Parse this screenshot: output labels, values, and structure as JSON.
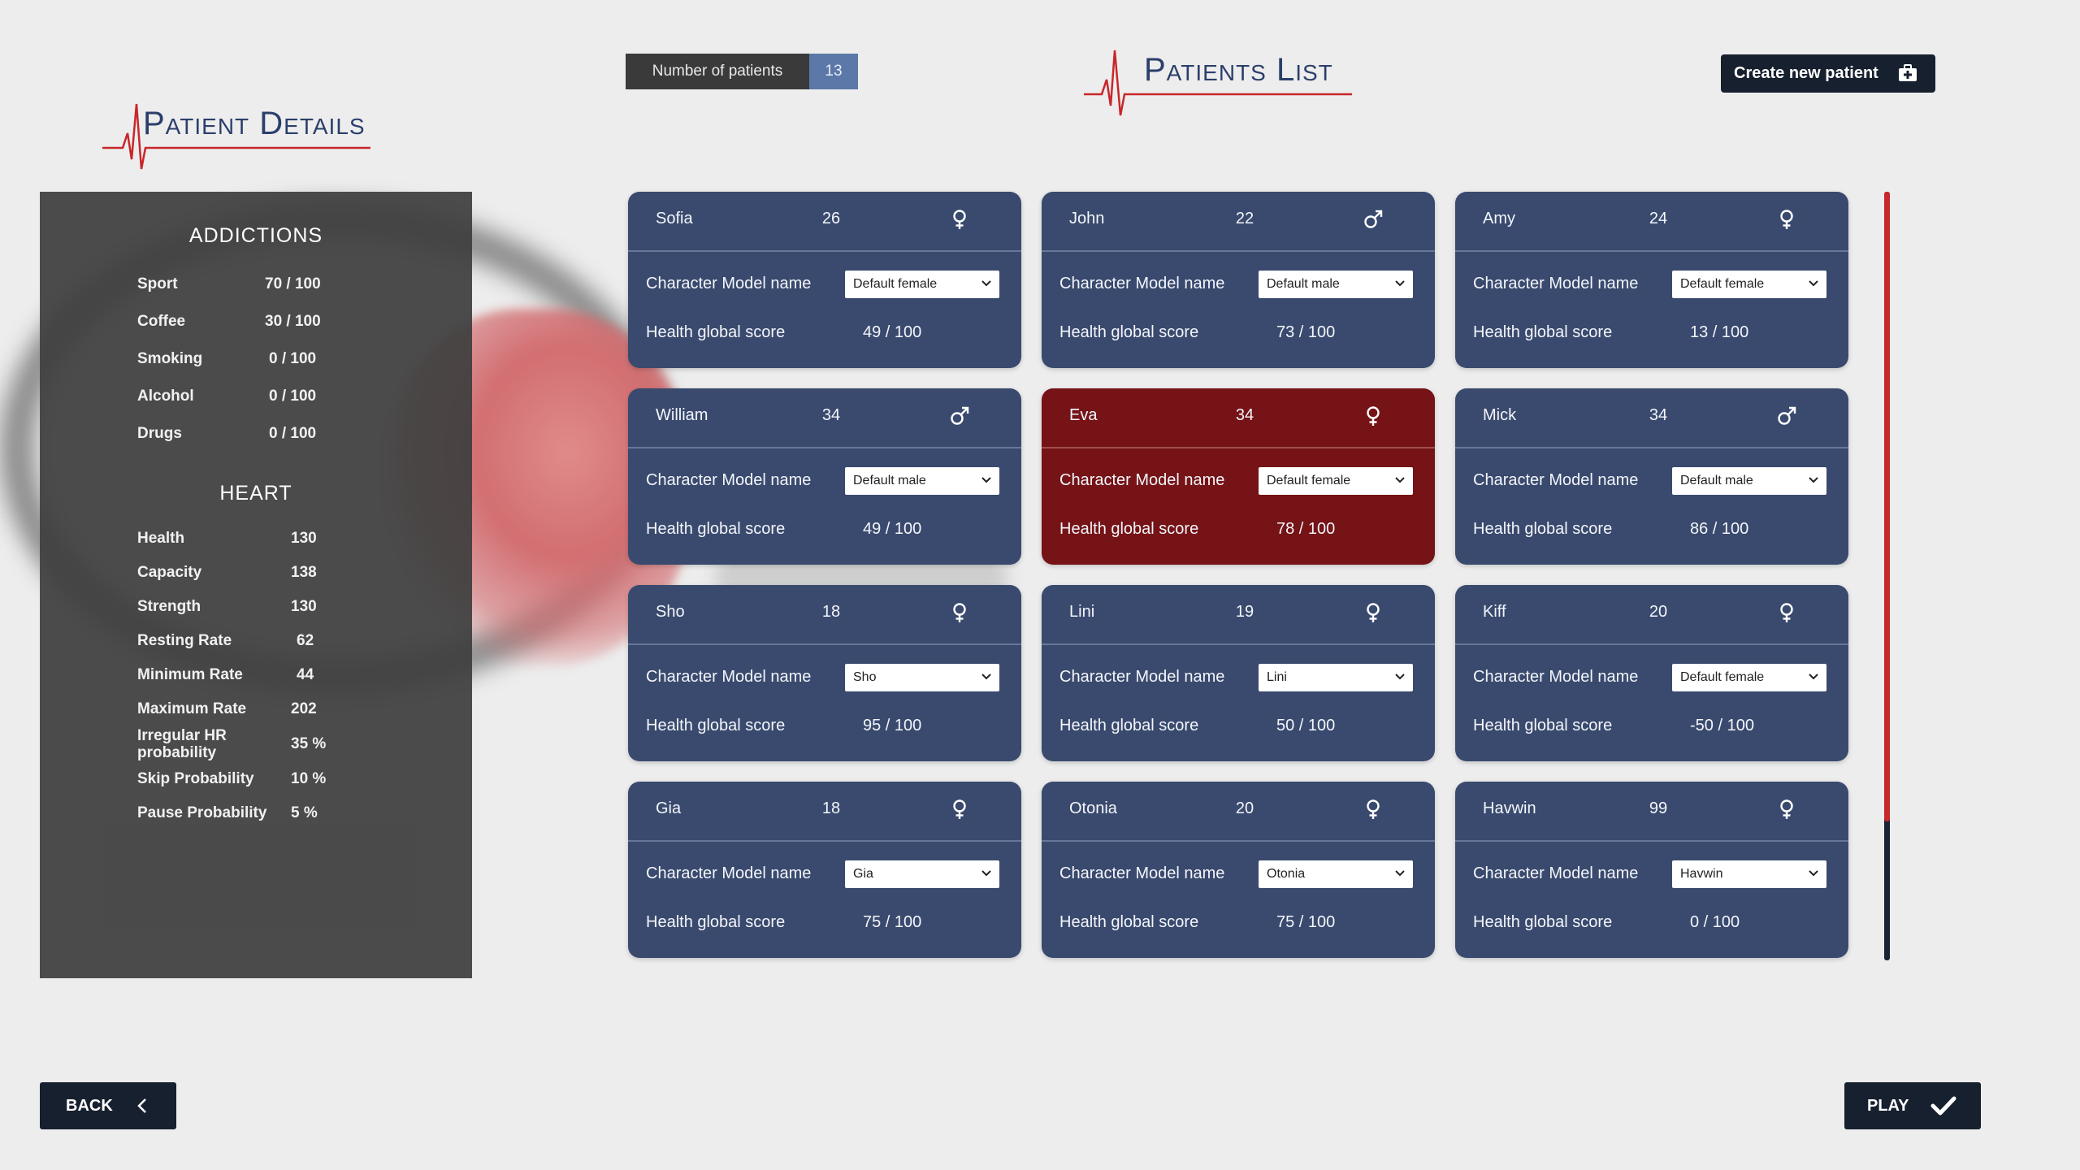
{
  "header": {
    "details_title": "Patient Details",
    "list_title": "Patients List",
    "patients_count_label": "Number of patients",
    "patients_count_value": "13",
    "create_button": "Create new patient"
  },
  "details": {
    "addictions_title": "ADDICTIONS",
    "addictions": [
      {
        "label": "Sport",
        "value": "70 / 100"
      },
      {
        "label": "Coffee",
        "value": "30 / 100"
      },
      {
        "label": "Smoking",
        "value": "0 / 100"
      },
      {
        "label": "Alcohol",
        "value": "0 / 100"
      },
      {
        "label": "Drugs",
        "value": "0 / 100"
      }
    ],
    "heart_title": "HEART",
    "heart": [
      {
        "label": "Health",
        "value": "130"
      },
      {
        "label": "Capacity",
        "value": "138"
      },
      {
        "label": "Strength",
        "value": "130"
      },
      {
        "label": "Resting Rate",
        "value": "62"
      },
      {
        "label": "Minimum Rate",
        "value": "44"
      },
      {
        "label": "Maximum Rate",
        "value": "202"
      },
      {
        "label": "Irregular HR probability",
        "value": "35 %"
      },
      {
        "label": "Skip Probability",
        "value": "10 %"
      },
      {
        "label": "Pause Probability",
        "value": "5 %"
      }
    ]
  },
  "cards": [
    {
      "name": "Sofia",
      "age": "26",
      "gender": "female",
      "model_label": "Character Model name",
      "model": "Default female",
      "score_label": "Health global score",
      "score": "49 / 100",
      "selected": false
    },
    {
      "name": "John",
      "age": "22",
      "gender": "male",
      "model_label": "Character Model name",
      "model": "Default male",
      "score_label": "Health global score",
      "score": "73 / 100",
      "selected": false
    },
    {
      "name": "Amy",
      "age": "24",
      "gender": "female",
      "model_label": "Character Model name",
      "model": "Default female",
      "score_label": "Health global score",
      "score": "13 / 100",
      "selected": false
    },
    {
      "name": "William",
      "age": "34",
      "gender": "male",
      "model_label": "Character Model name",
      "model": "Default male",
      "score_label": "Health global score",
      "score": "49 / 100",
      "selected": false
    },
    {
      "name": "Eva",
      "age": "34",
      "gender": "female",
      "model_label": "Character Model name",
      "model": "Default female",
      "score_label": "Health global score",
      "score": "78 / 100",
      "selected": true
    },
    {
      "name": "Mick",
      "age": "34",
      "gender": "male",
      "model_label": "Character Model name",
      "model": "Default male",
      "score_label": "Health global score",
      "score": "86 / 100",
      "selected": false
    },
    {
      "name": "Sho",
      "age": "18",
      "gender": "female",
      "model_label": "Character Model name",
      "model": "Sho",
      "score_label": "Health global score",
      "score": "95 / 100",
      "selected": false
    },
    {
      "name": "Lini",
      "age": "19",
      "gender": "female",
      "model_label": "Character Model name",
      "model": "Lini",
      "score_label": "Health global score",
      "score": "50 / 100",
      "selected": false
    },
    {
      "name": "Kiff",
      "age": "20",
      "gender": "female",
      "model_label": "Character Model name",
      "model": "Default female",
      "score_label": "Health global score",
      "score": "-50 / 100",
      "selected": false
    },
    {
      "name": "Gia",
      "age": "18",
      "gender": "female",
      "model_label": "Character Model name",
      "model": "Gia",
      "score_label": "Health global score",
      "score": "75 / 100",
      "selected": false
    },
    {
      "name": "Otonia",
      "age": "20",
      "gender": "female",
      "model_label": "Character Model name",
      "model": "Otonia",
      "score_label": "Health global score",
      "score": "75 / 100",
      "selected": false
    },
    {
      "name": "Havwin",
      "age": "99",
      "gender": "female",
      "model_label": "Character Model name",
      "model": "Havwin",
      "score_label": "Health global score",
      "score": "0 / 100",
      "selected": false
    }
  ],
  "scroll_fraction_visible": 0.82,
  "footer": {
    "back_button": "BACK",
    "play_button": "PLAY"
  },
  "colors": {
    "card": "#3a4a6e",
    "card_selected": "#751316",
    "accent_red": "#c8272b",
    "heading": "#2b3f6b",
    "button_dark": "#17202e"
  }
}
